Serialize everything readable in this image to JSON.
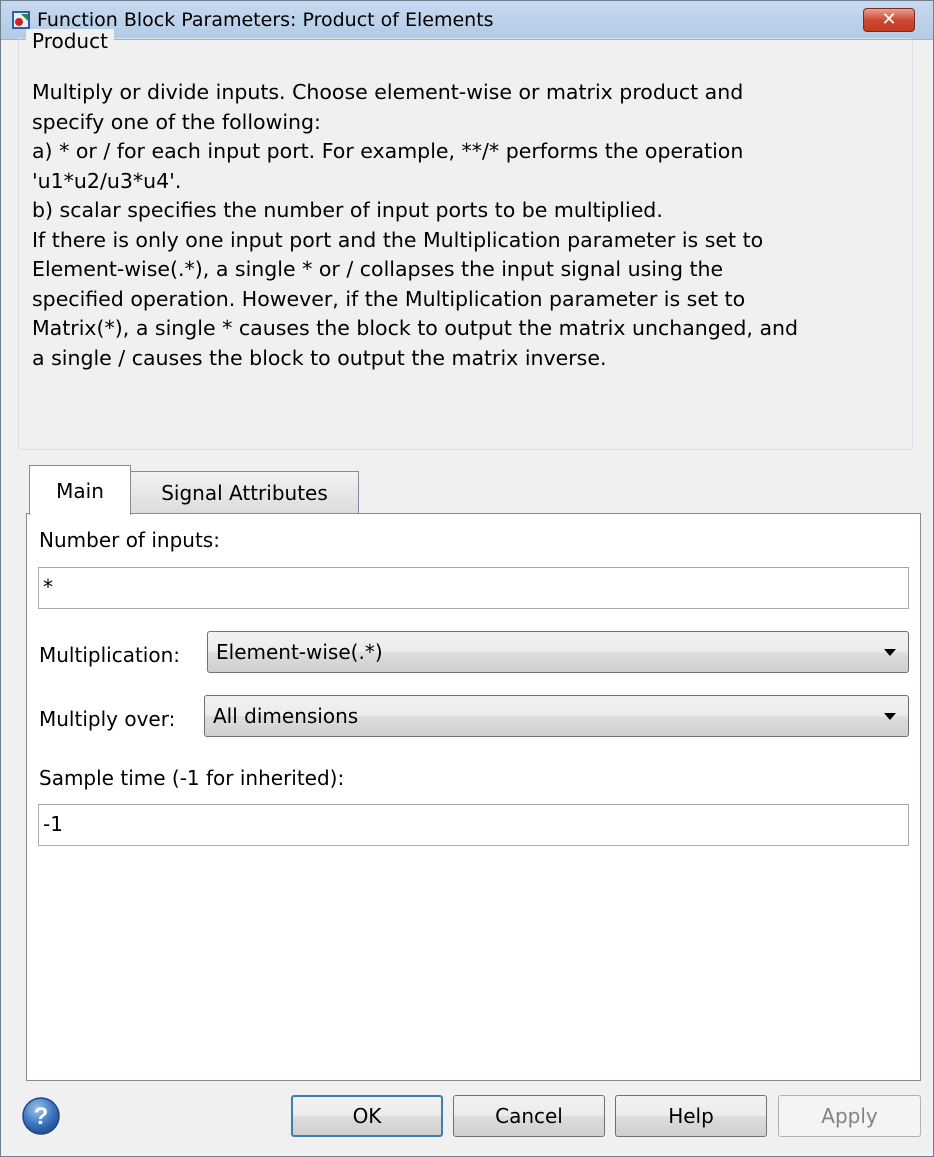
{
  "window": {
    "title": "Function Block Parameters: Product of Elements",
    "close_label": "✕"
  },
  "group": {
    "legend": "Product",
    "description_lines": [
      "Multiply or divide inputs.  Choose element-wise or matrix product and",
      "specify one of the following:",
      " a) * or / for each input port. For example, **/* performs the operation",
      "'u1*u2/u3*u4'.",
      " b) scalar specifies the number of input ports to be multiplied.",
      "If there is only one input port and the Multiplication parameter is set to",
      "Element-wise(.*), a single * or / collapses the input signal using the",
      "specified operation. However, if the Multiplication parameter is set to",
      "Matrix(*), a single * causes the block to output the matrix unchanged, and",
      "a single / causes the block to output the matrix inverse."
    ]
  },
  "tabs": [
    {
      "label": "Main",
      "selected": true
    },
    {
      "label": "Signal Attributes",
      "selected": false
    }
  ],
  "main": {
    "number_of_inputs": {
      "label": "Number of inputs:",
      "value": "*"
    },
    "multiplication": {
      "label": "Multiplication:",
      "value": "Element-wise(.*)"
    },
    "multiply_over": {
      "label": "Multiply over:",
      "value": "All dimensions"
    },
    "sample_time": {
      "label": "Sample time (-1 for inherited):",
      "value": "-1"
    }
  },
  "buttons": {
    "ok": "OK",
    "cancel": "Cancel",
    "help": "Help",
    "apply": "Apply"
  },
  "icons": {
    "app": "simulink-block-icon",
    "help": "question-circle-icon"
  },
  "colors": {
    "titlebar": "#b9d1ea",
    "close": "#c7402a",
    "focus_border": "#3c7fb1"
  }
}
